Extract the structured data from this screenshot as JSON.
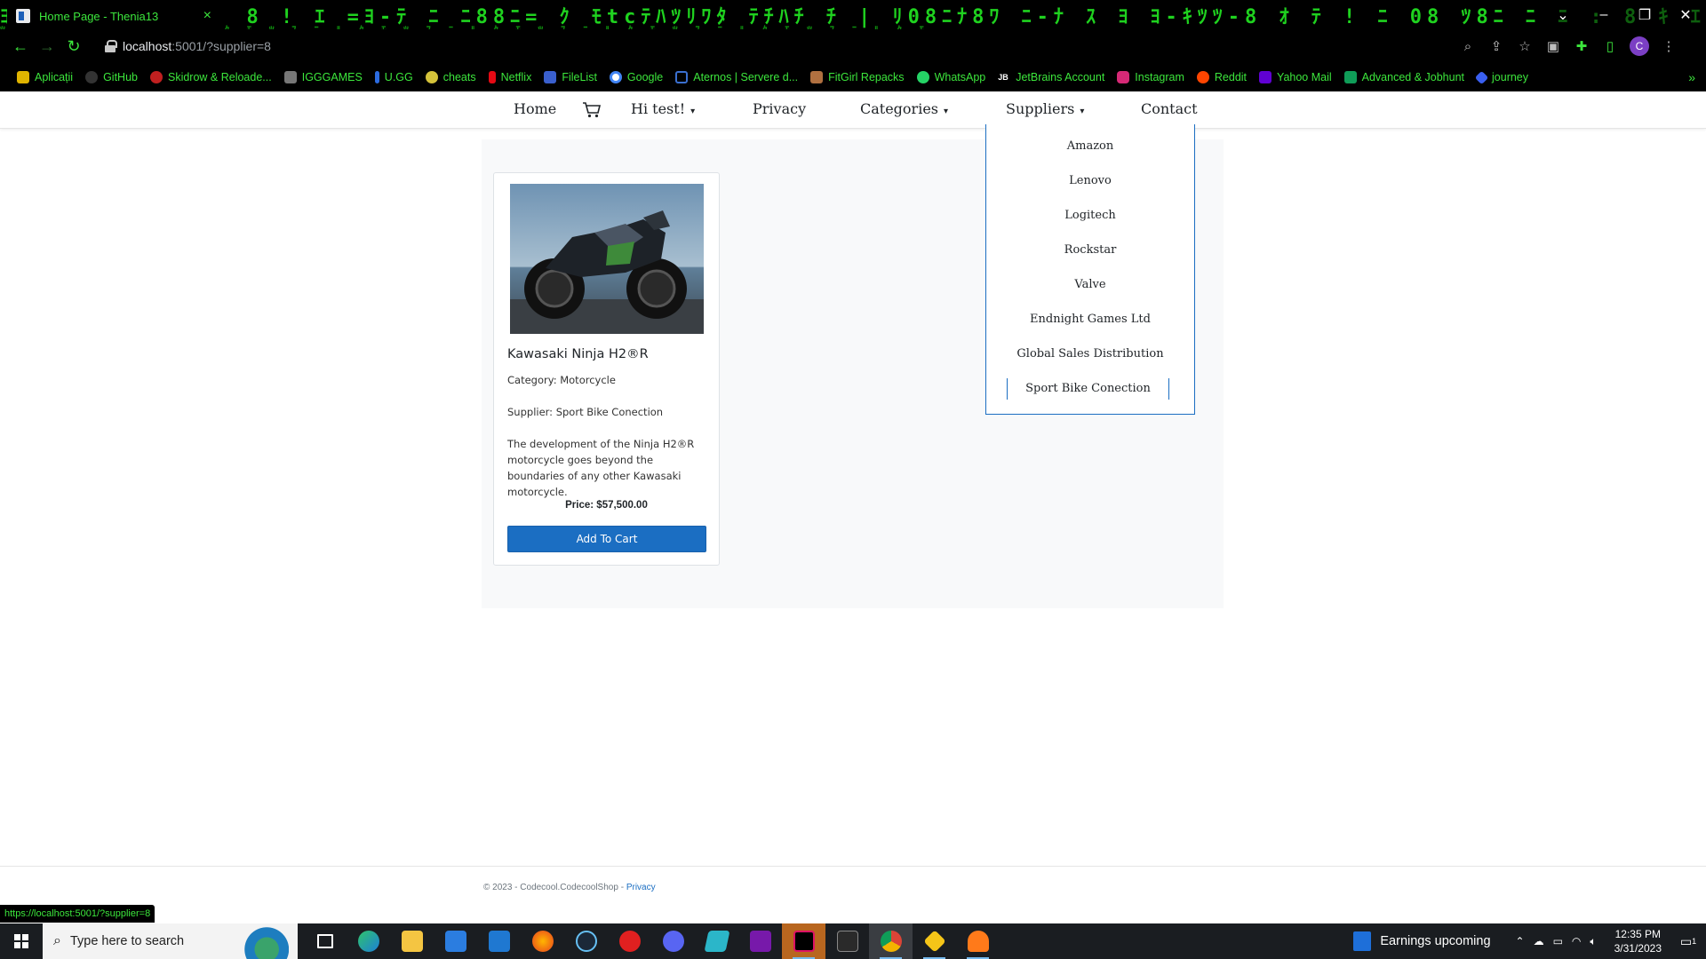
{
  "browser": {
    "tab_title": "Home Page - Thenia13",
    "tab_close": "×",
    "matrix_top": "ﾖ8+78ﾅ ﾆ  ｲ ｽ  :  8  ! ｴ =ﾖ-ﾃ  ﾆ  ﾆ88ﾆ= ｸ  ﾓtcﾃﾊﾂﾘﾜﾀ ﾃﾁﾊﾁ ﾁ  | ﾘ08ﾆﾅ8ﾜ ﾆ-ﾅ ｽ  ﾖ  ﾖ-ｷﾂﾂ-8 ｵ ﾃ  ! ﾆ 08  ﾂ8ﾆ ﾆ  ﾆ  :  8  ｷ  ｴ ﾆ=ﾖ",
    "matrix_bottom": "ﾂ ｽ ﾆ ﾙ ｸ ﾓ ﾂ ｽ ﾆ ﾙ ｸ ﾓ ﾂ ｽ ﾆ ﾙ ｸ ﾓ ﾂ ｽ ﾆ ﾙ ｸ ﾓ ﾂ ｽ ﾆ ﾙ ｸ ﾓ ﾂ ｽ ﾆ ﾙ ｸ ﾓ ﾂ ｽ ﾆ ﾙ ｸ ﾓ",
    "url_host": "localhost",
    "url_rest": ":5001/?supplier=8",
    "profile_initial": "C",
    "status_url": "https://localhost:5001/?supplier=8"
  },
  "bookmarks": [
    {
      "label": "Aplicații",
      "color": "#e0b400"
    },
    {
      "label": "GitHub",
      "color": "#333333"
    },
    {
      "label": "Skidrow & Reloade...",
      "color": "#c02020"
    },
    {
      "label": "IGGGAMES",
      "color": "#777777"
    },
    {
      "label": "U.GG",
      "color": "#2b6be0"
    },
    {
      "label": "cheats",
      "color": "#d4c23a"
    },
    {
      "label": "Netflix",
      "color": "#e50914"
    },
    {
      "label": "FileList",
      "color": "#3a5fcd"
    },
    {
      "label": "Google",
      "color": "#4285f4"
    },
    {
      "label": "Aternos | Servere d...",
      "color": "#3a6fd0"
    },
    {
      "label": "FitGirl Repacks",
      "color": "#b07040"
    },
    {
      "label": "WhatsApp",
      "color": "#25d366"
    },
    {
      "label": "JetBrains Account",
      "color": "#ffffff"
    },
    {
      "label": "Instagram",
      "color": "#d62976"
    },
    {
      "label": "Reddit",
      "color": "#ff4500"
    },
    {
      "label": "Yahoo Mail",
      "color": "#6001d2"
    },
    {
      "label": "Advanced & Jobhunt",
      "color": "#0f9d58"
    },
    {
      "label": "journey",
      "color": "#3a5ff0"
    }
  ],
  "bookmarks_more": "»",
  "nav": {
    "home": "Home",
    "user": "Hi test!",
    "privacy": "Privacy",
    "categories": "Categories",
    "suppliers": "Suppliers",
    "contact": "Contact",
    "caret": "▾"
  },
  "suppliers_menu": [
    "Amazon",
    "Lenovo",
    "Logitech",
    "Rockstar",
    "Valve",
    "Endnight Games Ltd",
    "Global Sales Distribution",
    "Sport Bike Conection"
  ],
  "product": {
    "name": "Kawasaki Ninja H2®R",
    "category": "Category: Motorcycle",
    "supplier": "Supplier: Sport Bike Conection",
    "description": "The development of the Ninja H2®R motorcycle goes beyond the boundaries of any other Kawasaki motorcycle.",
    "price": "Price: $57,500.00",
    "add_to_cart": "Add To Cart"
  },
  "footer": {
    "copyright": "© 2023 - Codecool.CodecoolShop - ",
    "privacy": "Privacy"
  },
  "taskbar": {
    "search_placeholder": "Type here to search",
    "news": "Earnings upcoming",
    "time": "12:35 PM",
    "date": "3/31/2023",
    "notification_count": "1"
  },
  "colors": {
    "accent": "#1b6ec2",
    "matrix_green": "#3ce63c"
  }
}
